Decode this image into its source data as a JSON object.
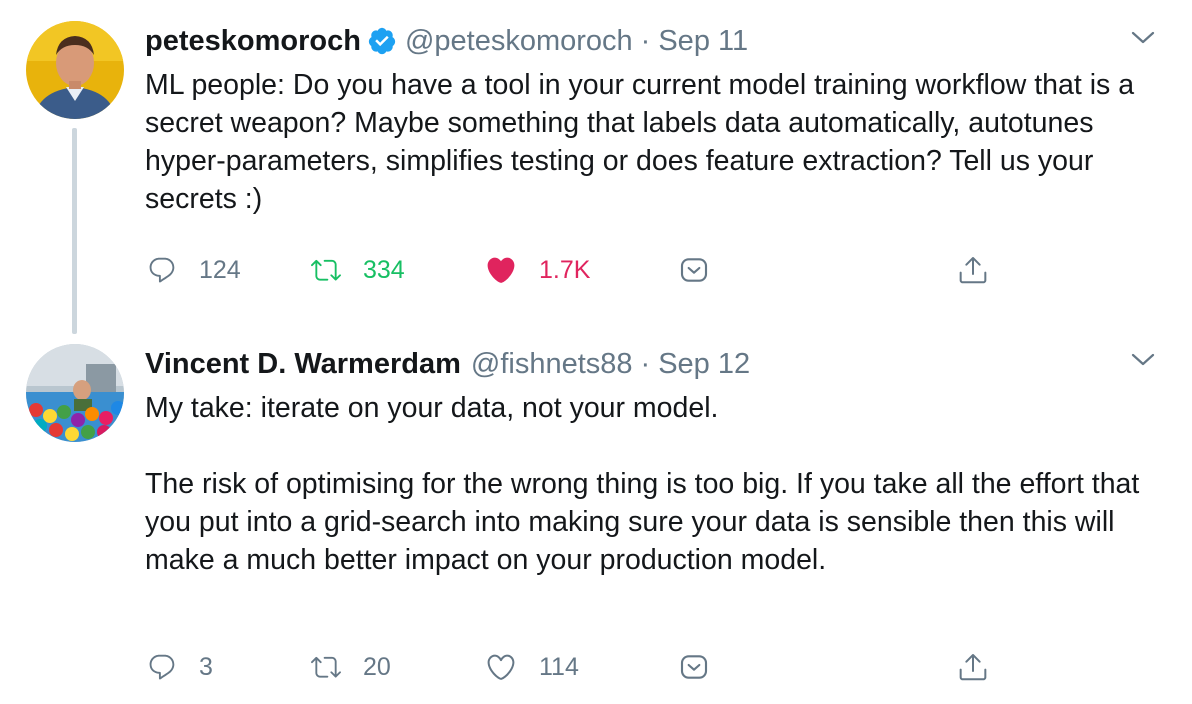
{
  "tweets": [
    {
      "author": {
        "display_name": "peteskomoroch",
        "handle": "@peteskomoroch",
        "verified": true,
        "avatar_icon": "person-avatar"
      },
      "separator": "·",
      "date": "Sep 11",
      "text": "ML people: Do you have a tool in your current model training workflow that is a secret weapon? Maybe something that labels data automatically, autotunes hyper-parameters, simplifies testing or does feature extraction? Tell us your secrets :)",
      "actions": {
        "replies": "124",
        "retweets": "334",
        "likes": "1.7K",
        "retweeted": true,
        "liked": true
      }
    },
    {
      "author": {
        "display_name": "Vincent D. Warmerdam",
        "handle": "@fishnets88",
        "verified": false,
        "avatar_icon": "ball-pit-avatar"
      },
      "separator": "·",
      "date": "Sep 12",
      "text_paragraphs": [
        "My take: iterate on your data, not your model.",
        "The risk of optimising for the wrong thing is too big. If you take all the effort that you put into a grid-search into making sure your data is sensible then this will make a much better impact on your production model."
      ],
      "actions": {
        "replies": "3",
        "retweets": "20",
        "likes": "114",
        "retweeted": false,
        "liked": false
      }
    }
  ],
  "colors": {
    "text": "#14171a",
    "secondary": "#657786",
    "verified": "#1da1f2",
    "retweet_active": "#17bf63",
    "like_active": "#e0245e",
    "thread_line": "#ccd6dd"
  }
}
